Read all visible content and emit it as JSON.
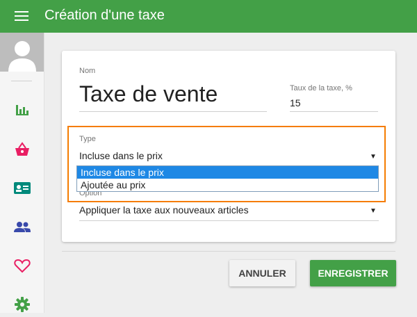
{
  "header": {
    "title": "Création d'une taxe"
  },
  "sidebar": {
    "icons": [
      "avatar-icon",
      "bar-chart-icon",
      "basket-icon",
      "contact-card-icon",
      "people-icon",
      "heart-icon",
      "gear-icon"
    ]
  },
  "form": {
    "name_label": "Nom",
    "name_value": "Taxe de vente",
    "rate_label": "Taux de la taxe, %",
    "rate_value": "15",
    "type_label": "Type",
    "type_value": "Incluse dans le prix",
    "type_options": [
      "Incluse dans le prix",
      "Ajoutée au prix"
    ],
    "option_label": "Option",
    "option_value": "Appliquer la taxe aux nouveaux articles"
  },
  "actions": {
    "cancel_label": "ANNULER",
    "save_label": "ENREGISTRER"
  },
  "colors": {
    "primary": "#43a047",
    "accent_highlight": "#f57c00",
    "selected_option": "#1e88e5"
  }
}
